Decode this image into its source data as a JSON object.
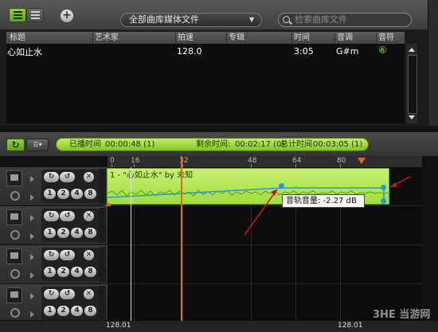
{
  "toolbar": {
    "media_select": "全部曲库媒体文件",
    "search_placeholder": "检索曲库文件",
    "add_label": "+"
  },
  "columns": [
    "标题",
    "艺术家",
    "拍速",
    "专辑",
    "时间",
    "音调",
    "音符"
  ],
  "tracks": [
    {
      "title": "心如止水",
      "artist": "",
      "tempo": "128.0",
      "album": "",
      "time": "3:05",
      "key": "G#m",
      "note": "⑥"
    }
  ],
  "transport": {
    "elapsed_label": "已播时间",
    "elapsed_value": "00:00:48 (1)",
    "remaining_label": "剩余时间:",
    "remaining_value": "00:02:17 (0)",
    "total_label": "总计时间",
    "total_value": "00:03:05 (1)"
  },
  "ruler": [
    "0",
    "16",
    "32",
    "48",
    "64",
    "80"
  ],
  "track_buttons": {
    "pills": [
      "1",
      "2",
      "4",
      "8"
    ],
    "close": "✕"
  },
  "clip": {
    "title": "1 - \"心如止水\" by 未知",
    "tooltip": "音轨音量: -2.27 dB"
  },
  "bottom": {
    "bpm_left": "128.01",
    "bpm_right": "128.01"
  },
  "watermark": "3HE 当游网",
  "colors": {
    "accent_green": "#a2dc3e",
    "playhead": "#e86a10",
    "arrow": "#c81818",
    "keyframe": "#1e9be0"
  }
}
